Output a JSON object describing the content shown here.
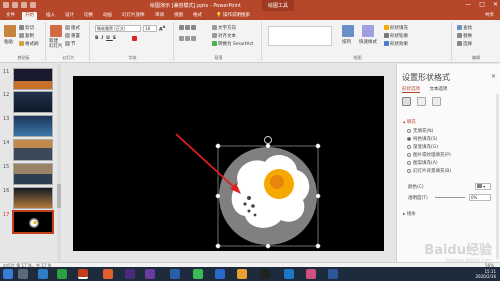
{
  "app": {
    "title": "绘图演示 [兼容模式].pptx - PowerPoint",
    "context_tab": "绘图工具",
    "window_controls": [
      "—",
      "□",
      "✕"
    ]
  },
  "ribbon": {
    "tabs": [
      "文件",
      "开始",
      "插入",
      "设计",
      "切换",
      "动画",
      "幻灯片放映",
      "审阅",
      "视图",
      "格式"
    ],
    "active_tab": "开始",
    "tell_me": "操作说明搜索",
    "share": "共享",
    "groups": {
      "clipboard": {
        "label": "剪贴板",
        "paste": "粘贴",
        "cut": "剪切",
        "copy": "复制",
        "format_painter": "格式刷"
      },
      "slides": {
        "label": "幻灯片",
        "new_slide": "新建\n幻灯片",
        "layout": "版式",
        "reset": "重置",
        "section": "节"
      },
      "font": {
        "label": "字体",
        "font_name": "微软雅黑 (正文)",
        "font_size": "18"
      },
      "paragraph": {
        "label": "段落",
        "text_direction": "文字方向",
        "align_text": "对齐文本",
        "smartart": "转换为 SmartArt"
      },
      "drawing": {
        "label": "绘图",
        "arrange": "排列",
        "quick_styles": "快速样式",
        "fill": "形状填充",
        "outline": "形状轮廓",
        "effects": "形状效果"
      },
      "editing": {
        "label": "编辑",
        "find": "查找",
        "replace": "替换",
        "select": "选择"
      }
    }
  },
  "slides_panel": {
    "items": [
      {
        "num": "11",
        "current": false
      },
      {
        "num": "12",
        "current": false
      },
      {
        "num": "13",
        "current": false
      },
      {
        "num": "14",
        "current": false
      },
      {
        "num": "15",
        "current": false
      },
      {
        "num": "16",
        "current": false
      },
      {
        "num": "17",
        "current": true
      }
    ]
  },
  "format_pane": {
    "title": "设置形状格式",
    "close": "✕",
    "tabs": [
      "形状选项",
      "文本选项"
    ],
    "active_tab": "形状选项",
    "fill_section": "填充",
    "fill_options": [
      "无填充(N)",
      "纯色填充(S)",
      "渐变填充(G)",
      "图片或纹理填充(P)",
      "图案填充(A)",
      "幻灯片背景填充(B)"
    ],
    "fill_selected": "纯色填充(S)",
    "color_label": "颜色(C)",
    "transparency_label": "透明度(T)",
    "transparency_value": "0%",
    "line_section": "线条"
  },
  "status_bar": {
    "slide_info": "幻灯片 第 17 张，共 17 张",
    "zoom": "56%"
  },
  "taskbar": {
    "time": "15:11",
    "date": "2020/2/16"
  },
  "watermark": {
    "text": "Baidu经验",
    "sub": "jingyan.baidu.com"
  },
  "colors": {
    "accent": "#b7472a",
    "selection": "#c43e1c",
    "slide_bg": "#000000",
    "plate": "#808080",
    "egg_white": "#ffffff",
    "yolk_outer": "#f5a800",
    "yolk_inner": "#e8860c",
    "arrow": "#e02020"
  }
}
